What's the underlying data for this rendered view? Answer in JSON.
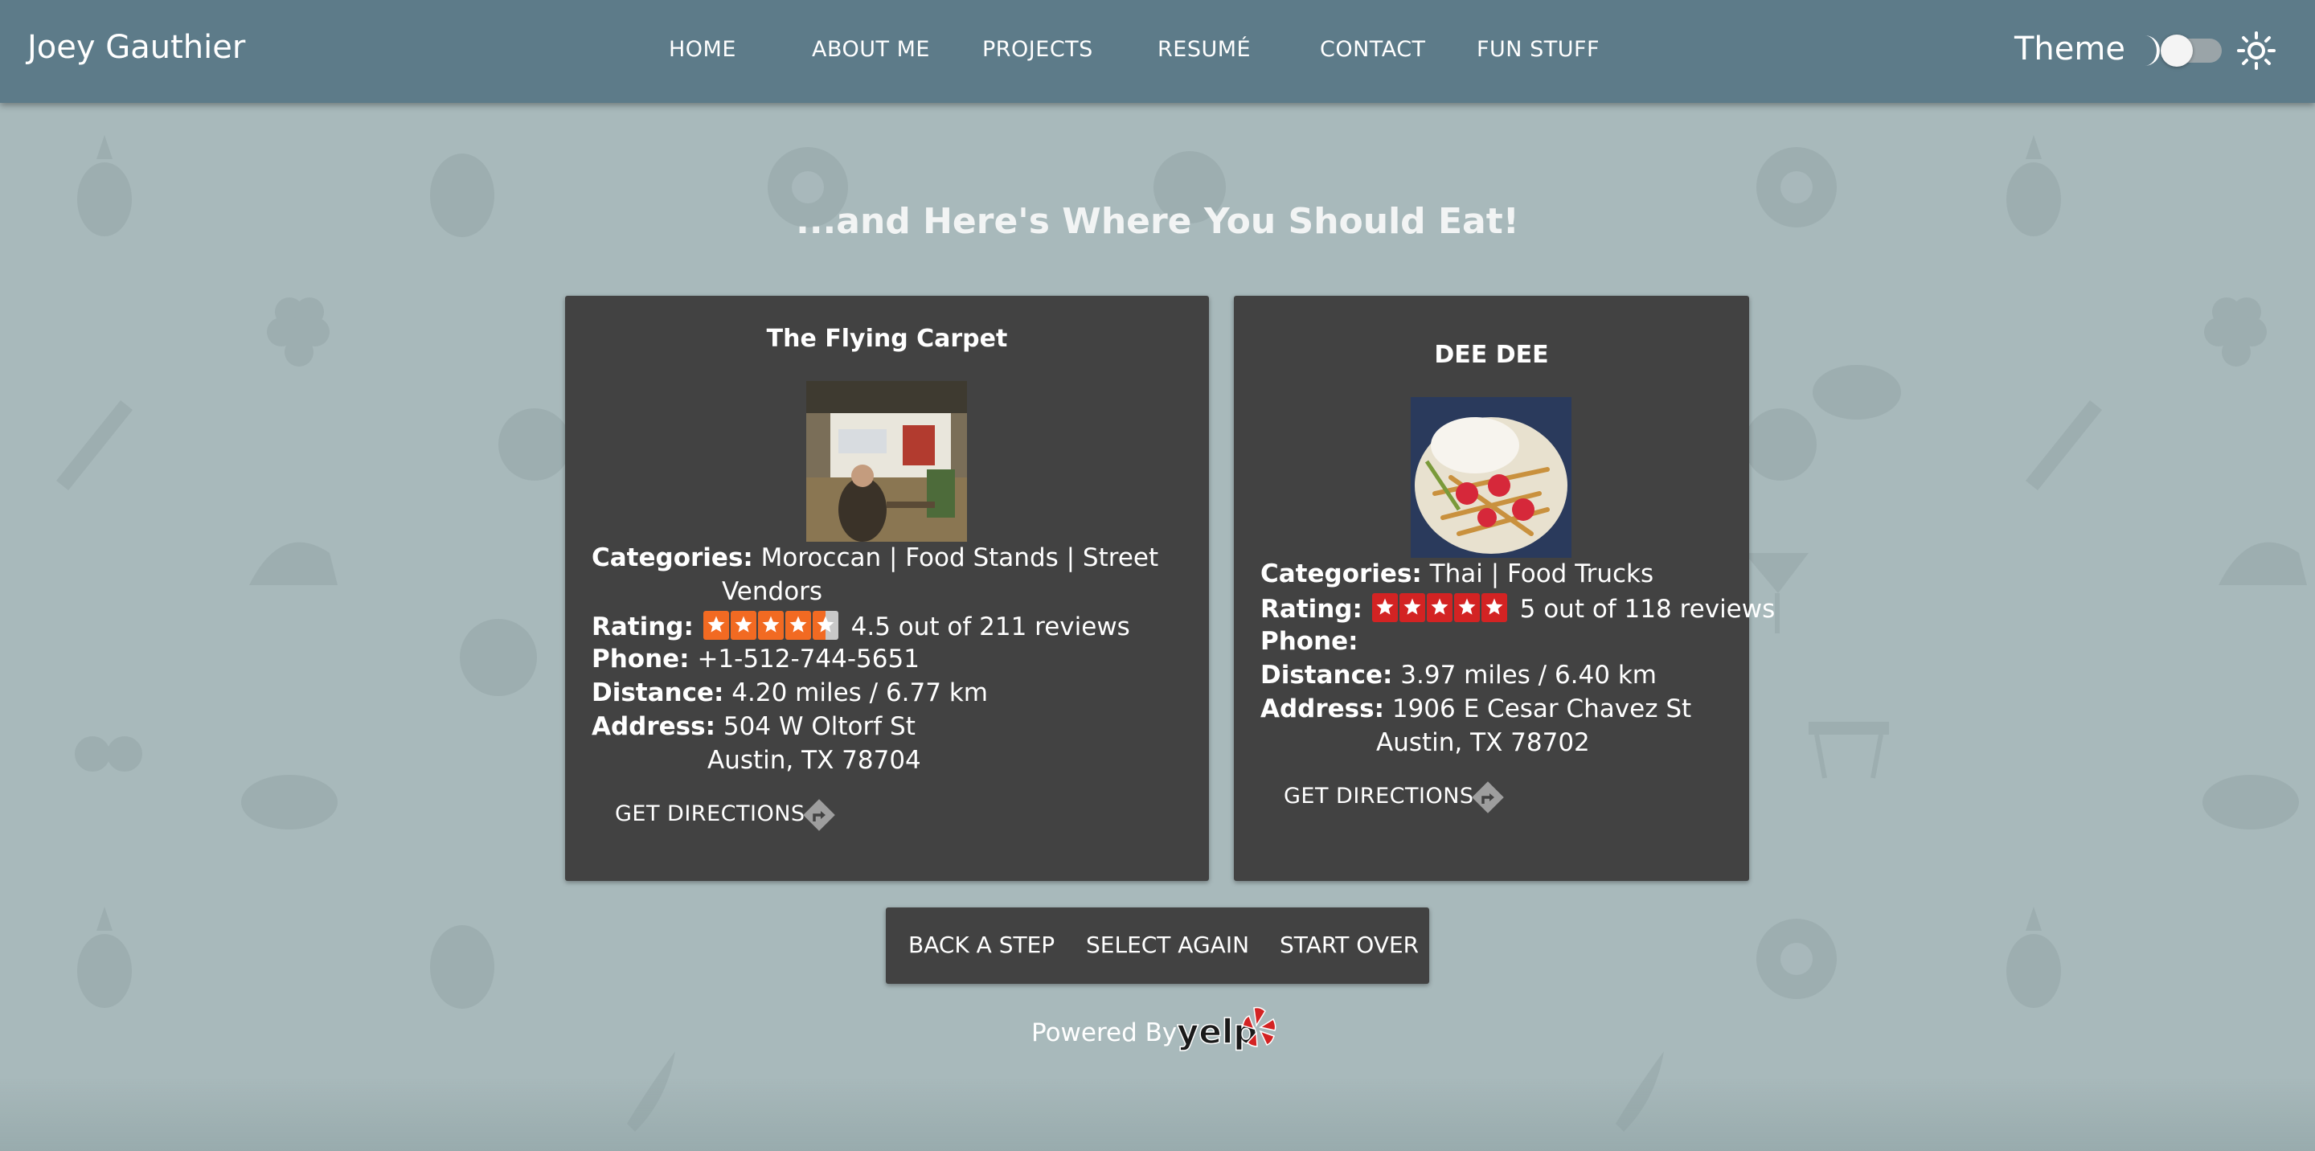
{
  "brand": "Joey Gauthier",
  "nav": {
    "items": [
      {
        "label": "HOME"
      },
      {
        "label": "ABOUT ME"
      },
      {
        "label": "PROJECTS"
      },
      {
        "label": "RESUMÉ"
      },
      {
        "label": "CONTACT"
      },
      {
        "label": "FUN STUFF"
      }
    ],
    "theme_label": "Theme"
  },
  "page": {
    "title": "...and Here's Where You Should Eat!"
  },
  "restaurants": [
    {
      "name": "The Flying Carpet",
      "categories_label": "Categories:",
      "categories_line1": "Moroccan | Food Stands | Street",
      "categories_line2": "Vendors",
      "rating_label": "Rating:",
      "rating_value": 4.5,
      "rating_text": "4.5 out of 211 reviews",
      "phone_label": "Phone:",
      "phone": "+1-512-744-5651",
      "distance_label": "Distance:",
      "distance": "4.20 miles / 6.77 km",
      "address_label": "Address:",
      "address_line1": "504 W Oltorf St",
      "address_line2": "Austin, TX 78704",
      "directions_label": "GET DIRECTIONS",
      "star_color": "#f26a22"
    },
    {
      "name": "DEE DEE",
      "categories_label": "Categories:",
      "categories_line1": "Thai | Food Trucks",
      "rating_label": "Rating:",
      "rating_value": 5,
      "rating_text": "5 out of 118 reviews",
      "phone_label": "Phone:",
      "phone": "",
      "distance_label": "Distance:",
      "distance": "3.97 miles / 6.40 km",
      "address_label": "Address:",
      "address_line1": "1906 E Cesar Chavez St",
      "address_line2": "Austin, TX 78702",
      "directions_label": "GET DIRECTIONS",
      "star_color": "#d32323"
    }
  ],
  "actions": {
    "back": "BACK A STEP",
    "select_again": "SELECT AGAIN",
    "start_over": "START OVER"
  },
  "footer": {
    "powered_by": "Powered By",
    "yelp_logo_text": "yelp"
  },
  "colors": {
    "navbar": "#5d7b89",
    "background": "#a8b9bb",
    "card": "#424242"
  },
  "icons": [
    "moon-icon",
    "sun-icon",
    "star-icon",
    "directions-icon",
    "yelp-burst-icon"
  ]
}
